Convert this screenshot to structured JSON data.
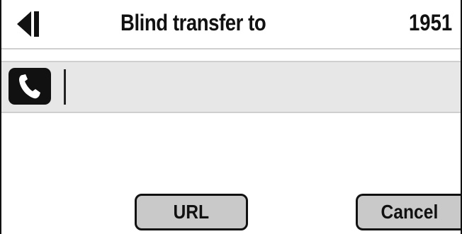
{
  "header": {
    "back_icon": "back-arrow-icon",
    "title": "Blind transfer to",
    "line_number": "1951"
  },
  "dial": {
    "phone_icon": "phone-handset-icon",
    "value": "",
    "placeholder": ""
  },
  "softkeys": [
    {
      "label": "URL"
    },
    {
      "label": "Cancel"
    }
  ],
  "colors": {
    "background": "#ffffff",
    "dial_row": "#e7e7e7",
    "softkey_fill": "#c9c9c9",
    "text": "#111111"
  }
}
